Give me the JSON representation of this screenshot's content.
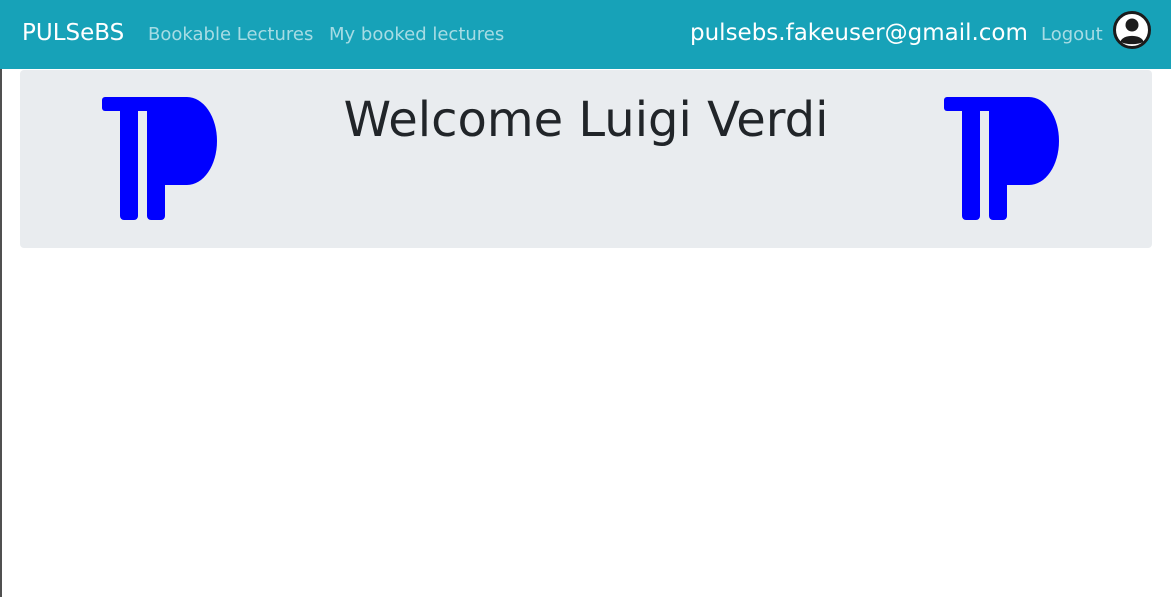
{
  "navbar": {
    "brand": "PULSeBS",
    "links": [
      "Bookable Lectures",
      "My booked lectures"
    ],
    "user_email": "pulsebs.fakeuser@gmail.com",
    "logout_label": "Logout",
    "background_color": "#17a2b8",
    "user_icon": "user-circle-icon"
  },
  "welcome": {
    "title": "Welcome Luigi Verdi",
    "logo_icon": "tp-logo",
    "logo_color": "#0000ff",
    "background_color": "#e9ecef"
  }
}
